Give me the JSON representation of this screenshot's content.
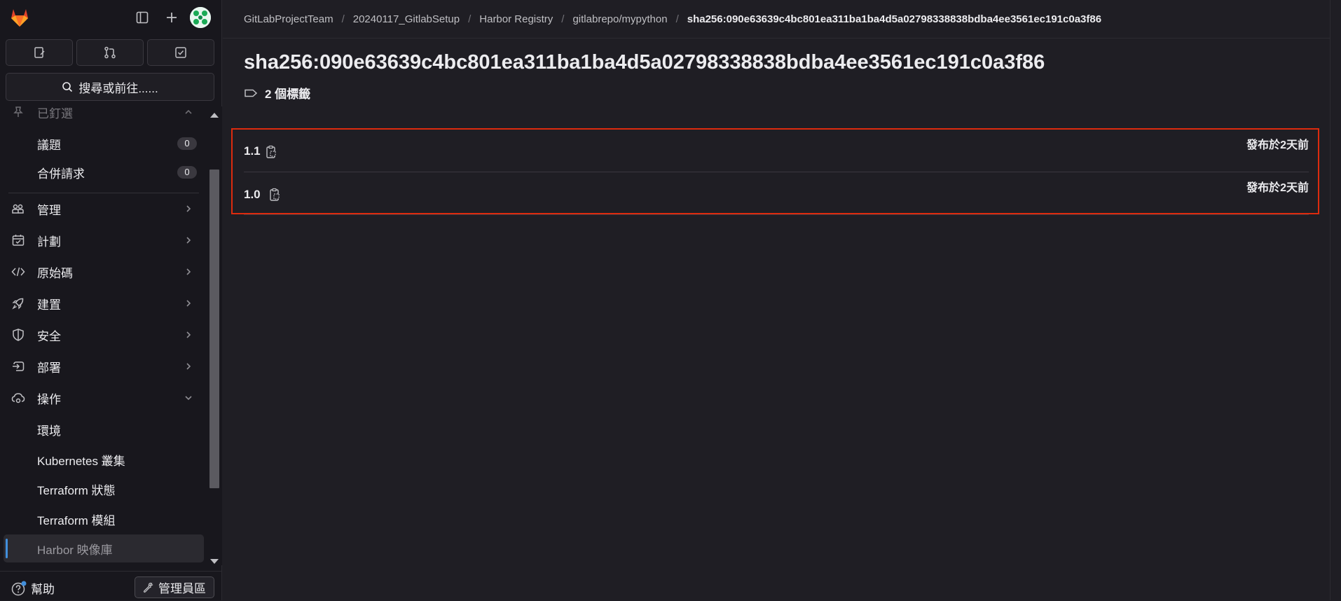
{
  "sidebar": {
    "top_icons": [
      "sidebar-toggle-icon",
      "plus-icon"
    ],
    "search_label": "搜尋或前往......",
    "partial_item_label": "已釘選",
    "items": [
      {
        "label": "議題",
        "count": "0"
      },
      {
        "label": "合併請求",
        "count": "0"
      },
      {
        "label": "管理",
        "icon": "users-icon"
      },
      {
        "label": "計劃",
        "icon": "calendar-icon"
      },
      {
        "label": "原始碼",
        "icon": "code-icon"
      },
      {
        "label": "建置",
        "icon": "rocket-icon"
      },
      {
        "label": "安全",
        "icon": "shield-icon"
      },
      {
        "label": "部署",
        "icon": "deploy-icon"
      },
      {
        "label": "操作",
        "icon": "cloud-gear-icon"
      }
    ],
    "sub_items": [
      {
        "label": "環境"
      },
      {
        "label": "Kubernetes 叢集"
      },
      {
        "label": "Terraform 狀態"
      },
      {
        "label": "Terraform 模組"
      },
      {
        "label": "Harbor 映像庫"
      }
    ],
    "help_label": "幫助",
    "admin_label": "管理員區"
  },
  "breadcrumb": [
    "GitLabProjectTeam",
    "20240117_GitlabSetup",
    "Harbor Registry",
    "gitlabrepo/mypython",
    "sha256:090e63639c4bc801ea311ba1ba4d5a02798338838bdba4ee3561ec191c0a3f86"
  ],
  "page": {
    "title": "sha256:090e63639c4bc801ea311ba1ba4d5a02798338838bdba4ee3561ec191c0a3f86",
    "tag_count": "2 個標籤"
  },
  "tags": [
    {
      "name": "1.1",
      "published": "發布於2天前"
    },
    {
      "name": "1.0",
      "published": "發布於2天前"
    }
  ],
  "colors": {
    "accent": "#428fdc",
    "highlight_border": "#dd2b0e",
    "background": "#1f1e24"
  }
}
